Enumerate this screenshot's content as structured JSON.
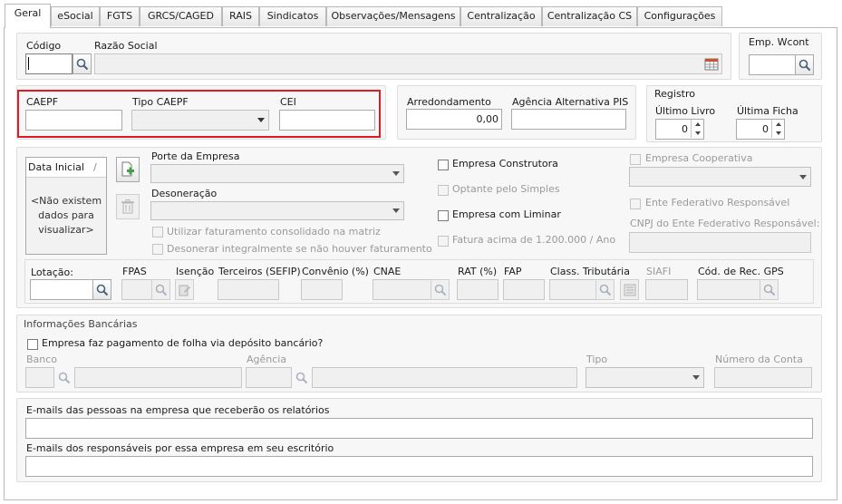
{
  "tabs": [
    {
      "label": "Geral"
    },
    {
      "label": "eSocial"
    },
    {
      "label": "FGTS"
    },
    {
      "label": "GRCS/CAGED"
    },
    {
      "label": "RAIS"
    },
    {
      "label": "Sindicatos"
    },
    {
      "label": "Observações/Mensagens"
    },
    {
      "label": "Centralização"
    },
    {
      "label": "Centralização CS"
    },
    {
      "label": "Configurações"
    }
  ],
  "company": {
    "codigo_label": "Código",
    "codigo_value": "",
    "razao_label": "Razão Social",
    "razao_value": "",
    "emp_wcont_label": "Emp. Wcont",
    "emp_wcont_value": ""
  },
  "caepf": {
    "caepf_label": "CAEPF",
    "tipo_label": "Tipo CAEPF",
    "cei_label": "CEI"
  },
  "arred": {
    "arredondamento_label": "Arredondamento",
    "arredondamento_value": "0,00",
    "agencia_pis_label": "Agência Alternativa PIS"
  },
  "registro": {
    "title": "Registro",
    "ultimo_livro_label": "Último Livro",
    "ultimo_livro_value": "0",
    "ultima_ficha_label": "Última Ficha",
    "ultima_ficha_value": "0"
  },
  "dates": {
    "header": "Data Inicial",
    "sort_glyph": "/",
    "empty_line1": "<Não existem",
    "empty_line2": "dados para",
    "empty_line3": "visualizar>"
  },
  "porte": {
    "porte_label": "Porte da Empresa",
    "desoneracao_label": "Desoneração",
    "utilizar_label": "Utilizar faturamento consolidado na matriz",
    "desonerar_label": "Desonerar integralmente se não houver faturamento"
  },
  "flags": {
    "construtora": "Empresa Construtora",
    "optante": "Optante pelo Simples",
    "liminar": "Empresa com Liminar",
    "fatura": "Fatura acima de 1.200.000 / Ano",
    "cooperativa": "Empresa Cooperativa",
    "ente": "Ente Federativo Responsável",
    "cnpj_ente": "CNPJ do Ente Federativo Responsável:"
  },
  "lotacao": {
    "lotacao": "Lotação:",
    "fpas": "FPAS",
    "isencao": "Isenção",
    "terceiros": "Terceiros (SEFIP)",
    "convenio": "Convênio (%)",
    "cnae": "CNAE",
    "rat": "RAT (%)",
    "fap": "FAP",
    "class_trib": "Class. Tributária",
    "siafi": "SIAFI",
    "cod_rec": "Cód. de Rec. GPS"
  },
  "bank": {
    "title": "Informações Bancárias",
    "deposito": "Empresa faz pagamento de folha via depósito bancário?",
    "banco": "Banco",
    "agencia": "Agência",
    "tipo": "Tipo",
    "conta": "Número da Conta"
  },
  "emails": {
    "label1": "E-mails das pessoas na empresa que receberão os relatórios",
    "label2": "E-mails dos responsáveis por essa empresa em seu escritório"
  },
  "colors": {
    "highlight": "#e01b24"
  },
  "icons": [
    "search-icon",
    "table-icon",
    "add-document-icon",
    "trash-icon",
    "list-icon",
    "chevron-down-icon"
  ]
}
